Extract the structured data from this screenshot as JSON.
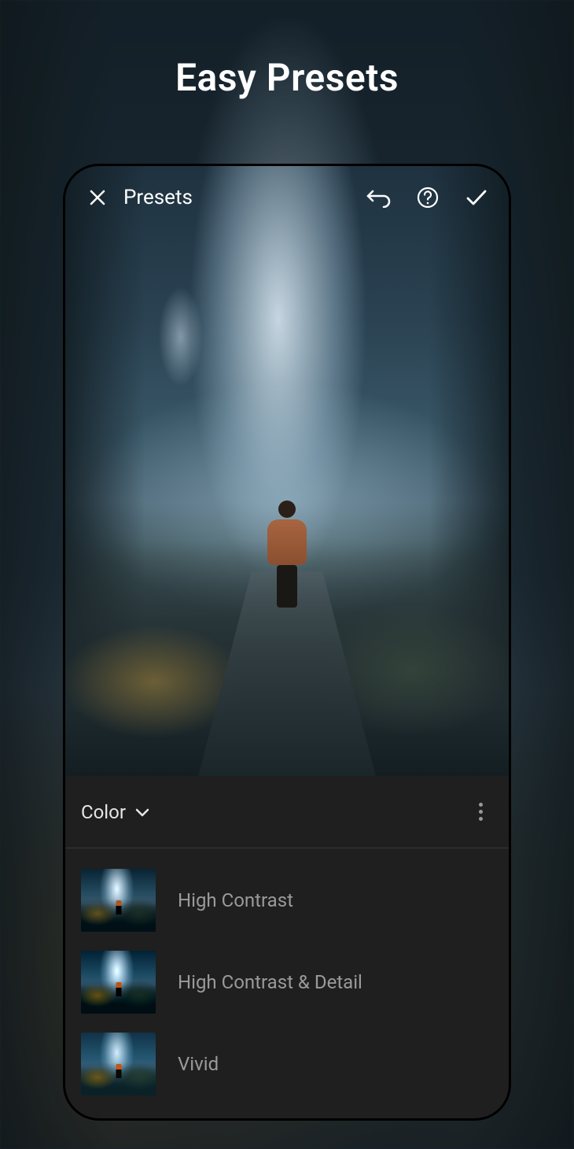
{
  "headline": "Easy Presets",
  "topbar": {
    "title": "Presets"
  },
  "category": {
    "label": "Color"
  },
  "presets": [
    {
      "name": "High Contrast"
    },
    {
      "name": "High Contrast & Detail"
    },
    {
      "name": "Vivid"
    }
  ]
}
